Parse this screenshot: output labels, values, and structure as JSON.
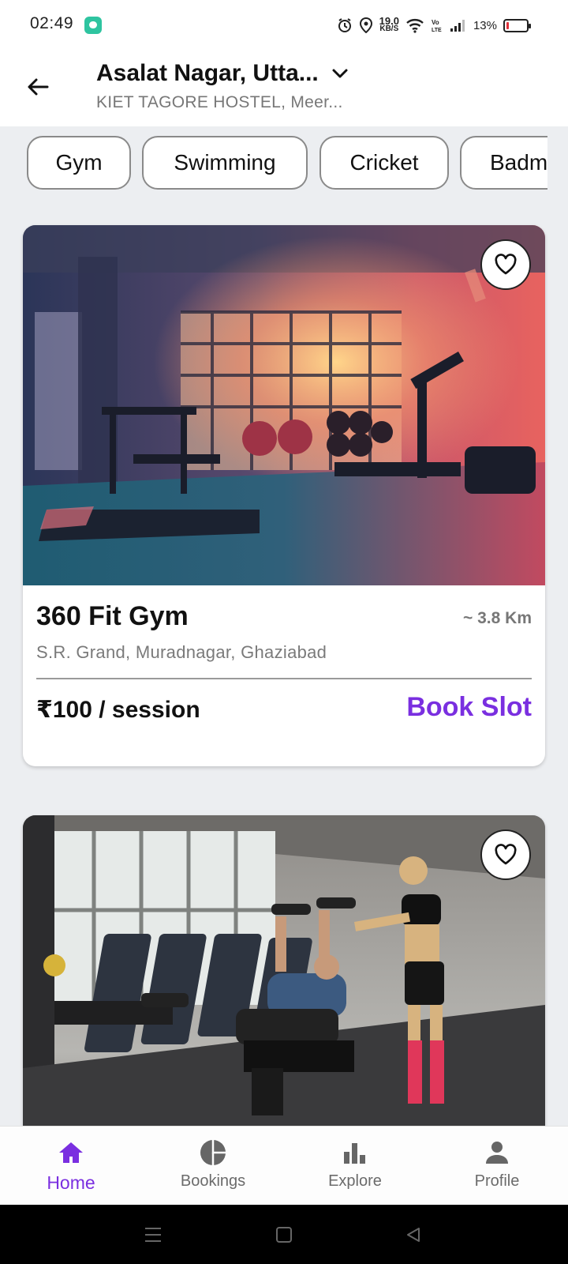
{
  "status_bar": {
    "time": "02:49",
    "net_speed_value": "19.0",
    "net_speed_unit": "KB/S",
    "battery_percent": "13%",
    "battery_level": 0.13,
    "icons": [
      "chat-app-icon",
      "alarm-icon",
      "location-icon",
      "wifi-icon",
      "volte-icon",
      "signal-icon",
      "battery-icon"
    ]
  },
  "header": {
    "location_title": "Asalat Nagar, Utta...",
    "location_subtitle": "KIET TAGORE HOSTEL, Meer..."
  },
  "categories": [
    "Gym",
    "Swimming",
    "Cricket",
    "Badm"
  ],
  "gyms": [
    {
      "name": "360 Fit Gym",
      "distance": "~ 3.8 Km",
      "address": "S.R. Grand, Muradnagar, Ghaziabad",
      "price": "₹100 / session",
      "action": "Book Slot"
    }
  ],
  "bottom_nav": {
    "home": "Home",
    "bookings": "Bookings",
    "explore": "Explore",
    "profile": "Profile",
    "active": "home"
  },
  "colors": {
    "accent": "#7a2fe0",
    "background": "#eceef1",
    "battery_low": "#e0313a"
  }
}
